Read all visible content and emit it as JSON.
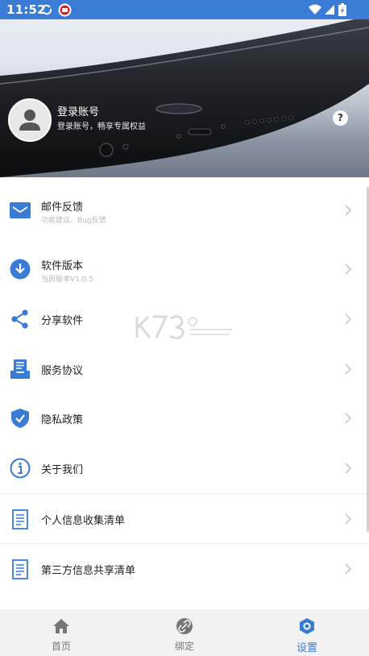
{
  "status_bar": {
    "time": "11:52"
  },
  "profile": {
    "title": "登录账号",
    "subtitle": "登录账号，畅享专属权益",
    "help_label": "?"
  },
  "menu": [
    {
      "title": "邮件反馈",
      "subtitle": "功能建议、Bug反馈",
      "icon": "mail-icon"
    },
    {
      "title": "软件版本",
      "subtitle": "当前版本V1.0.5",
      "icon": "download-icon"
    },
    {
      "title": "分享软件",
      "subtitle": "",
      "icon": "share-icon"
    },
    {
      "title": "服务协议",
      "subtitle": "",
      "icon": "agreement-icon"
    },
    {
      "title": "隐私政策",
      "subtitle": "",
      "icon": "shield-icon"
    },
    {
      "title": "关于我们",
      "subtitle": "",
      "icon": "info-icon"
    },
    {
      "title": "个人信息收集清单",
      "subtitle": "",
      "icon": "list-icon"
    },
    {
      "title": "第三方信息共享清单",
      "subtitle": "",
      "icon": "list-icon"
    }
  ],
  "tabs": [
    {
      "label": "首页",
      "icon": "home-icon"
    },
    {
      "label": "绑定",
      "icon": "link-icon"
    },
    {
      "label": "设置",
      "icon": "settings-icon"
    }
  ],
  "colors": {
    "accent": "#3a7bd5",
    "tab_inactive": "#777777",
    "tab_bar": "#f2f2f2"
  }
}
